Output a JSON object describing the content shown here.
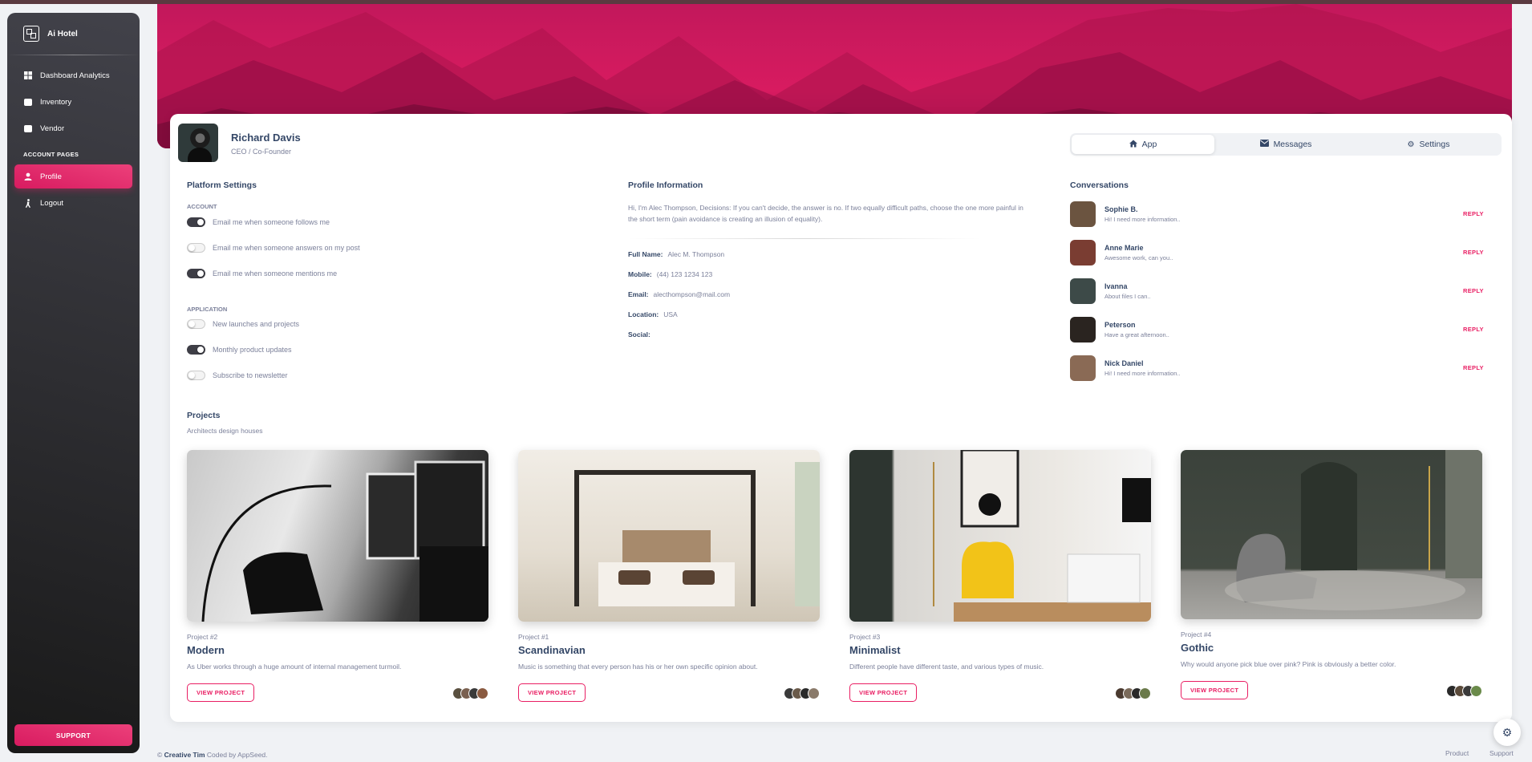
{
  "sidebar": {
    "brand": "Ai Hotel",
    "items": [
      {
        "label": "Dashboard Analytics"
      },
      {
        "label": "Inventory"
      },
      {
        "label": "Vendor"
      }
    ],
    "section": "ACCOUNT PAGES",
    "account_items": [
      {
        "label": "Profile"
      },
      {
        "label": "Logout"
      }
    ],
    "support": "SUPPORT"
  },
  "profile": {
    "name": "Richard Davis",
    "role": "CEO / Co-Founder"
  },
  "tabs": [
    {
      "label": "App",
      "icon": "home-icon"
    },
    {
      "label": "Messages",
      "icon": "email-icon"
    },
    {
      "label": "Settings",
      "icon": "gear-icon"
    }
  ],
  "platform": {
    "title": "Platform Settings",
    "account_label": "ACCOUNT",
    "account": [
      {
        "label": "Email me when someone follows me",
        "on": true
      },
      {
        "label": "Email me when someone answers on my post",
        "on": false
      },
      {
        "label": "Email me when someone mentions me",
        "on": true
      }
    ],
    "application_label": "APPLICATION",
    "application": [
      {
        "label": "New launches and projects",
        "on": false
      },
      {
        "label": "Monthly product updates",
        "on": true
      },
      {
        "label": "Subscribe to newsletter",
        "on": false
      }
    ]
  },
  "info": {
    "title": "Profile Information",
    "about": "Hi, I'm Alec Thompson, Decisions: If you can't decide, the answer is no. If two equally difficult paths, choose the one more painful in the short term (pain avoidance is creating an illusion of equality).",
    "full_name_label": "Full Name:",
    "full_name": "Alec M. Thompson",
    "mobile_label": "Mobile:",
    "mobile": "(44) 123 1234 123",
    "email_label": "Email:",
    "email": "alecthompson@mail.com",
    "location_label": "Location:",
    "location": "USA",
    "social_label": "Social:"
  },
  "conversations": {
    "title": "Conversations",
    "reply_label": "REPLY",
    "items": [
      {
        "name": "Sophie B.",
        "message": "Hi! I need more information..",
        "color": "#6b5440"
      },
      {
        "name": "Anne Marie",
        "message": "Awesome work, can you..",
        "color": "#7a3d32"
      },
      {
        "name": "Ivanna",
        "message": "About files I can..",
        "color": "#3d4a48"
      },
      {
        "name": "Peterson",
        "message": "Have a great afternoon..",
        "color": "#2a2420"
      },
      {
        "name": "Nick Daniel",
        "message": "Hi! I need more information..",
        "color": "#8a6a55"
      }
    ]
  },
  "projects": {
    "title": "Projects",
    "subtitle": "Architects design houses",
    "button_label": "VIEW PROJECT",
    "items": [
      {
        "label": "Project #2",
        "name": "Modern",
        "description": "As Uber works through a huge amount of internal management turmoil."
      },
      {
        "label": "Project #1",
        "name": "Scandinavian",
        "description": "Music is something that every person has his or her own specific opinion about."
      },
      {
        "label": "Project #3",
        "name": "Minimalist",
        "description": "Different people have different taste, and various types of music."
      },
      {
        "label": "Project #4",
        "name": "Gothic",
        "description": "Why would anyone pick blue over pink? Pink is obviously a better color."
      }
    ]
  },
  "footer": {
    "copyright": "©",
    "brand": "Creative Tim",
    "coded": "Coded by AppSeed.",
    "links": [
      "Product",
      "Support"
    ]
  },
  "colors": {
    "accent": "#e91e63",
    "sidebar": "#202024",
    "banner": "#d81b60"
  }
}
